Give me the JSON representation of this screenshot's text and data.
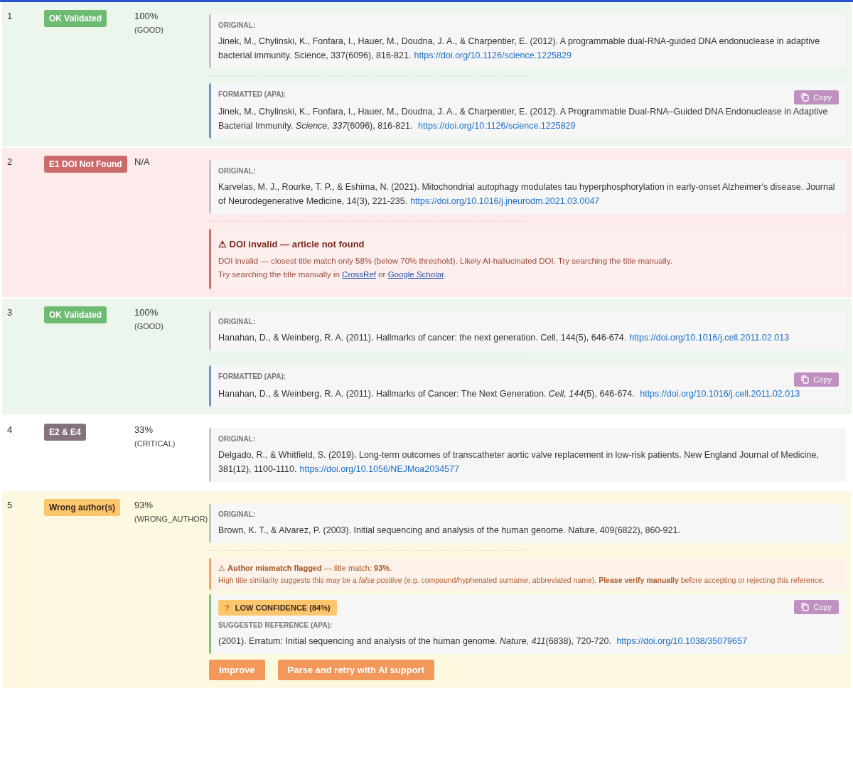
{
  "rows": [
    {
      "number": "1",
      "kind": "valid",
      "status": {
        "label": "OK Validated",
        "kind": "ok"
      },
      "score": "100%",
      "score_note": "(GOOD)",
      "blocks": [
        {
          "kind": "original",
          "label": "ORIGINAL:",
          "text": "Jinek, M., Chylinski, K., Fonfara, I., Hauer, M., Doudna, J. A., & Charpentier, E. (2012). A programmable dual-RNA-guided DNA endonuclease in adaptive bacterial immunity. Science, 337(6096), 816-821.",
          "link": "https://doi.org/10.1126/science.1225829"
        },
        {
          "kind": "formatted",
          "label": "FORMATTED (APA):",
          "copy": "Copy",
          "text": "Jinek, M., Chylinski, K., Fonfara, I., Hauer, M., Doudna, J. A., & Charpentier, E. (2012). A Programmable Dual-RNA–Guided DNA Endonuclease in Adaptive Bacterial Immunity. *Science, 337*(6096), 816-821.",
          "link": "https://doi.org/10.1126/science.1225829"
        }
      ]
    },
    {
      "number": "2",
      "kind": "error",
      "status": {
        "label": "E1 DOI Not Found",
        "kind": "error"
      },
      "score": "N/A",
      "blocks": [
        {
          "kind": "original",
          "label": "ORIGINAL:",
          "text": "Karvelas, M. J., Rourke, T. P., & Eshima, N. (2021). Mitochondrial autophagy modulates tau hyperphosphorylation in early-onset Alzheimer's disease. Journal of Neurodegenerative Medicine, 14(3), 221-235.",
          "link": "https://doi.org/10.1016/j.jneurodm.2021.03.0047"
        },
        {
          "kind": "error",
          "title": "⚠ DOI invalid — article not found",
          "message": "DOI invalid — closest title match only 58% (below 70% threshold). Likely AI-hallucinated DOI. Try searching the title manually.",
          "help_prefix": "Try searching the title manually in",
          "links": [
            "CrossRef",
            "Google Scholar"
          ],
          "joiner": "or",
          "suffix": "."
        }
      ]
    },
    {
      "number": "3",
      "kind": "valid",
      "status": {
        "label": "OK Validated",
        "kind": "ok"
      },
      "score": "100%",
      "score_note": "(GOOD)",
      "blocks": [
        {
          "kind": "original",
          "label": "ORIGINAL:",
          "text": "Hanahan, D., & Weinberg, R. A. (2011). Hallmarks of cancer: the next generation. Cell, 144(5), 646-674.",
          "link": "https://doi.org/10.1016/j.cell.2011.02.013"
        },
        {
          "kind": "formatted",
          "label": "FORMATTED (APA):",
          "copy": "Copy",
          "text": "Hanahan, D., & Weinberg, R. A. (2011). Hallmarks of Cancer: The Next Generation. *Cell, 144*(5), 646-674.",
          "link": "https://doi.org/10.1016/j.cell.2011.02.013"
        }
      ]
    },
    {
      "number": "4",
      "kind": "plain",
      "status": {
        "label": "E2 & E4",
        "kind": "mixed"
      },
      "score": "33%",
      "score_note": "(CRITICAL)",
      "blocks": [
        {
          "kind": "original",
          "label": "ORIGINAL:",
          "text": "Delgado, R., & Whitfield, S. (2019). Long-term outcomes of transcatheter aortic valve replacement in low-risk patients. New England Journal of Medicine, 381(12), 1100-1110.",
          "link": "https://doi.org/10.1056/NEJMoa2034577"
        }
      ]
    },
    {
      "number": "5",
      "kind": "warning",
      "status": {
        "label": "Wrong author(s)",
        "kind": "author"
      },
      "score": "93%",
      "score_note": "(WRONG_AUTHOR)",
      "blocks": [
        {
          "kind": "original",
          "label": "ORIGINAL:",
          "text": "Brown, K. T., & Alvarez, P. (2003). Initial sequencing and analysis of the human genome. Nature, 409(6822), 860-921."
        },
        {
          "kind": "notice",
          "title": "⚠ **Author mismatch flagged** — title match: **93%**.",
          "text": "High title similarity suggests this may be a *false positive* (e.g. compound/hyphenated surname, abbreviated name). **Please verify manually** before accepting or rejecting this reference."
        },
        {
          "kind": "suggestion",
          "badge_icon": "?",
          "badge": "LOW CONFIDENCE (84%)",
          "copy": "Copy",
          "label": "SUGGESTED REFERENCE (APA):",
          "text": "(2001). Erratum: Initial sequencing and analysis of the human genome. *Nature, 411*(6838), 720-720.",
          "link": "https://doi.org/10.1038/35079657"
        },
        {
          "kind": "actions",
          "buttons": [
            "Improve",
            "Parse and retry with AI support"
          ]
        }
      ]
    }
  ]
}
